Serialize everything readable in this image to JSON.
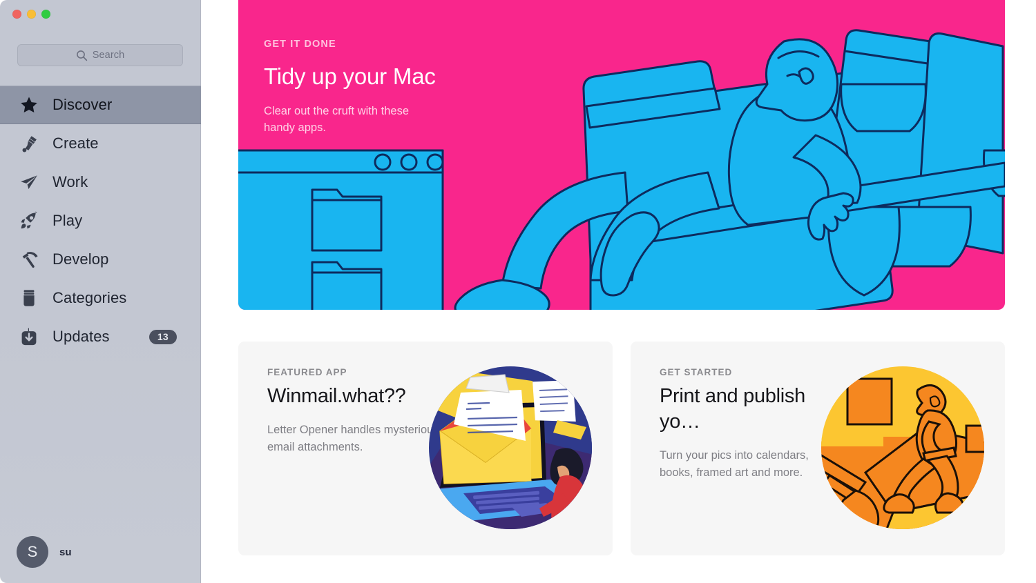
{
  "window": {
    "traffic_lights": [
      "close",
      "minimize",
      "maximize"
    ],
    "colors": {
      "sidebar_bg": "#c3c7d2",
      "selection": "#8e95a6",
      "hero_pink": "#f9268c",
      "hero_blue": "#19b5f0",
      "card_bg": "#f6f6f6",
      "close": "#f0645f",
      "minimize": "#f9be36",
      "maximize": "#2fcc41",
      "orange_art": "#f5871f",
      "orange_art_light": "#fcc631",
      "navy_art": "#2f3a8c",
      "yellow_art": "#f7d23e"
    }
  },
  "search": {
    "icon": "search-icon",
    "placeholder": "Search",
    "value": ""
  },
  "sidebar": {
    "items": [
      {
        "label": "Discover",
        "icon": "star-icon",
        "selected": true,
        "badge": ""
      },
      {
        "label": "Create",
        "icon": "paintbrush-icon",
        "selected": false,
        "badge": ""
      },
      {
        "label": "Work",
        "icon": "paperplane-icon",
        "selected": false,
        "badge": ""
      },
      {
        "label": "Play",
        "icon": "rocket-icon",
        "selected": false,
        "badge": ""
      },
      {
        "label": "Develop",
        "icon": "hammer-icon",
        "selected": false,
        "badge": ""
      },
      {
        "label": "Categories",
        "icon": "jar-icon",
        "selected": false,
        "badge": ""
      },
      {
        "label": "Updates",
        "icon": "download-icon",
        "selected": false,
        "badge": "13"
      }
    ],
    "account": {
      "avatar_initial": "S",
      "name": "su"
    }
  },
  "hero": {
    "eyebrow": "GET IT DONE",
    "title": "Tidy up your Mac",
    "subtitle": "Clear out the cruft with these handy apps.",
    "art": "person-carrying-folders-illustration"
  },
  "cards": [
    {
      "eyebrow": "FEATURED APP",
      "title": "Winmail.what??",
      "subtitle": "Letter Opener handles mysterious email attachments.",
      "art": "envelope-laptop-illustration"
    },
    {
      "eyebrow": "GET STARTED",
      "title": "Print and publish yo…",
      "subtitle": "Turn your pics into calendars, books, framed art and more.",
      "art": "person-running-print-illustration"
    }
  ]
}
